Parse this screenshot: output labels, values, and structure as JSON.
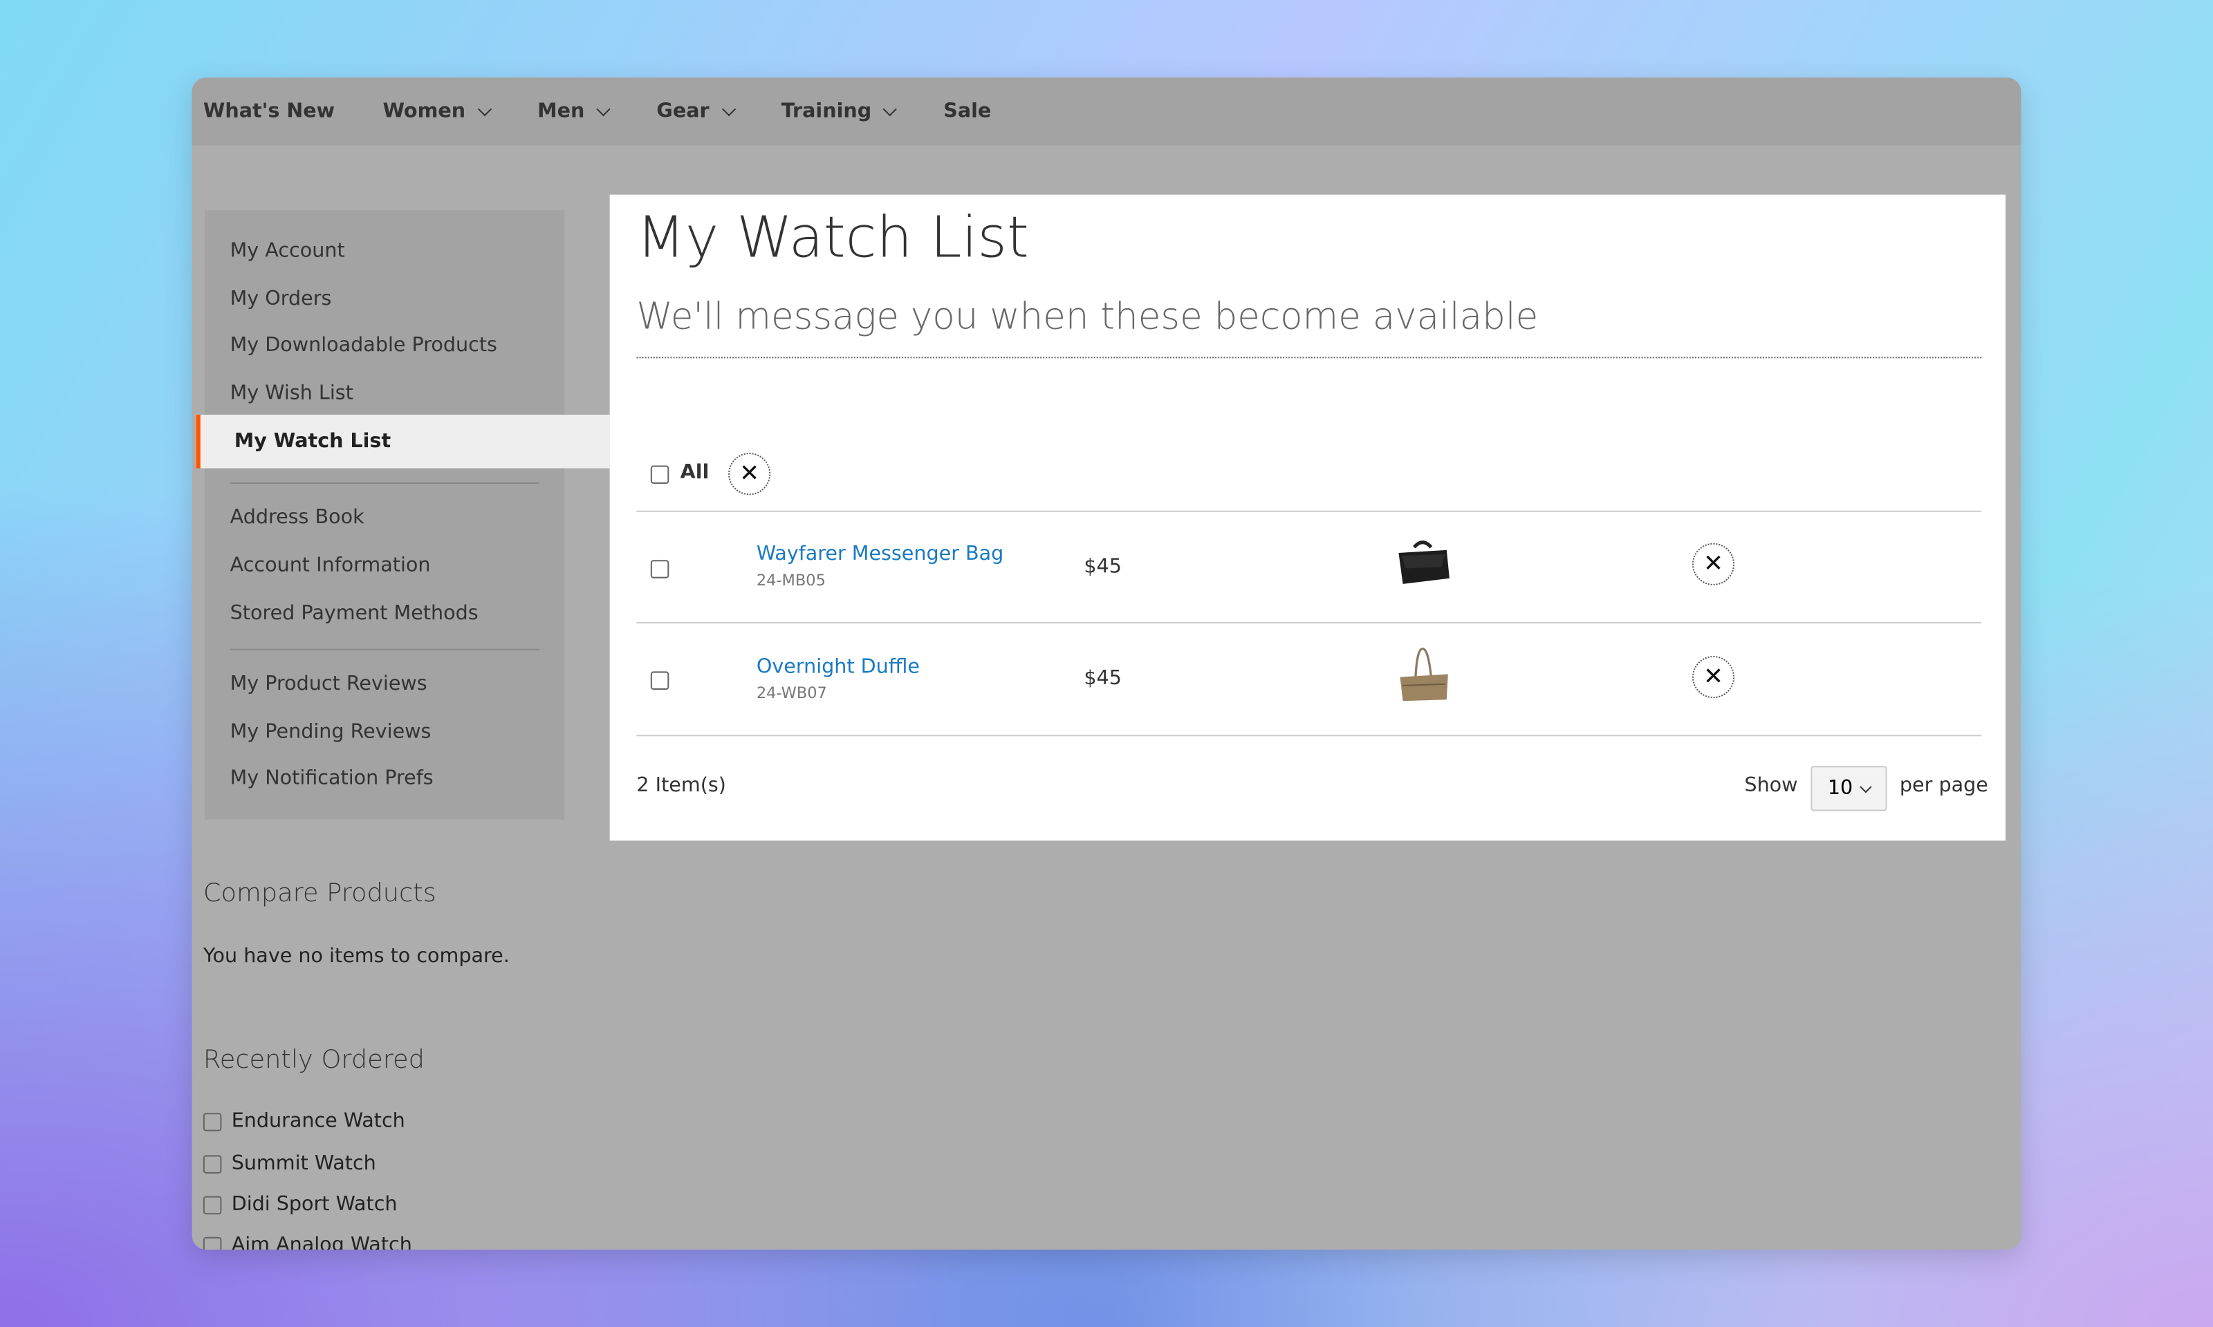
{
  "nav": [
    "What's New",
    "Women",
    "Men",
    "Gear",
    "Training",
    "Sale"
  ],
  "nav_has_dropdown": [
    false,
    true,
    true,
    true,
    true,
    false
  ],
  "sidebar": {
    "group1": [
      "My Account",
      "My Orders",
      "My Downloadable Products",
      "My Wish List"
    ],
    "active": "My Watch List",
    "group2": [
      "Address Book",
      "Account Information",
      "Stored Payment Methods"
    ],
    "group3": [
      "My Product Reviews",
      "My Pending Reviews",
      "My Notification Prefs"
    ]
  },
  "compare": {
    "title": "Compare Products",
    "text": "You have no items to compare."
  },
  "recent": {
    "title": "Recently Ordered",
    "items": [
      "Endurance Watch",
      "Summit Watch",
      "Didi Sport Watch",
      "Aim Analog Watch"
    ]
  },
  "main": {
    "title": "My Watch List",
    "subtitle": "We'll message you when these become available",
    "select_all": "All",
    "items": [
      {
        "name": "Wayfarer Messenger Bag",
        "sku": "24-MB05",
        "price": "$45",
        "image": "black-messenger-bag"
      },
      {
        "name": "Overnight Duffle",
        "sku": "24-WB07",
        "price": "$45",
        "image": "tan-duffle-bag"
      }
    ],
    "count": "2 Item(s)",
    "show": "Show",
    "per_page_value": "10",
    "per_page": "per page"
  },
  "colors": {
    "accent": "#ff5501",
    "link": "#1979c3"
  }
}
